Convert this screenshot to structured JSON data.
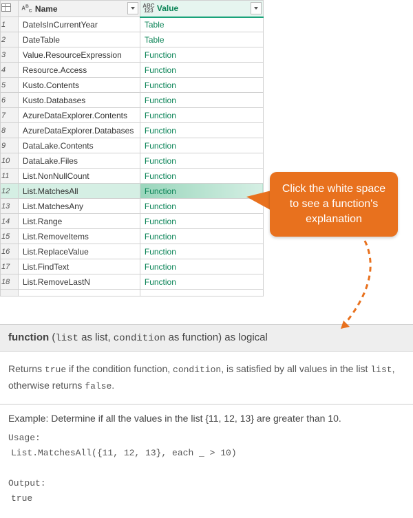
{
  "columns": {
    "name_label": "Name",
    "value_label": "Value",
    "name_type": "ABC",
    "value_type_top": "ABC",
    "value_type_bot": "123"
  },
  "rows": [
    {
      "n": "1",
      "name": "DateIsInCurrentYear",
      "value": "Table"
    },
    {
      "n": "2",
      "name": "DateTable",
      "value": "Table"
    },
    {
      "n": "3",
      "name": "Value.ResourceExpression",
      "value": "Function"
    },
    {
      "n": "4",
      "name": "Resource.Access",
      "value": "Function"
    },
    {
      "n": "5",
      "name": "Kusto.Contents",
      "value": "Function"
    },
    {
      "n": "6",
      "name": "Kusto.Databases",
      "value": "Function"
    },
    {
      "n": "7",
      "name": "AzureDataExplorer.Contents",
      "value": "Function"
    },
    {
      "n": "8",
      "name": "AzureDataExplorer.Databases",
      "value": "Function"
    },
    {
      "n": "9",
      "name": "DataLake.Contents",
      "value": "Function"
    },
    {
      "n": "10",
      "name": "DataLake.Files",
      "value": "Function"
    },
    {
      "n": "11",
      "name": "List.NonNullCount",
      "value": "Function"
    },
    {
      "n": "12",
      "name": "List.MatchesAll",
      "value": "Function"
    },
    {
      "n": "13",
      "name": "List.MatchesAny",
      "value": "Function"
    },
    {
      "n": "14",
      "name": "List.Range",
      "value": "Function"
    },
    {
      "n": "15",
      "name": "List.RemoveItems",
      "value": "Function"
    },
    {
      "n": "16",
      "name": "List.ReplaceValue",
      "value": "Function"
    },
    {
      "n": "17",
      "name": "List.FindText",
      "value": "Function"
    },
    {
      "n": "18",
      "name": "List.RemoveLastN",
      "value": "Function"
    }
  ],
  "partial_row": {
    "n": "",
    "name": "",
    "value": ""
  },
  "selected_row": "12",
  "callout": "Click the white space to see a function's explanation",
  "signature": {
    "kw1": "function",
    "open": " (",
    "arg1": "list",
    "as1": " as list, ",
    "arg2": "condition",
    "as2": " as function) as logical"
  },
  "description": {
    "t1": "Returns ",
    "c1": "true",
    "t2": " if the condition function, ",
    "c2": "condition",
    "t3": ", is satisfied by all values in the list ",
    "c3": "list",
    "t4": ", otherwise returns ",
    "c4": "false",
    "t5": "."
  },
  "example": {
    "title": "Example: Determine if all the values in the list {11, 12, 13} are greater than 10.",
    "usage_label": "Usage:",
    "usage_code": "List.MatchesAll({11, 12, 13}, each _  > 10)",
    "output_label": "Output:",
    "output_code": "true"
  }
}
